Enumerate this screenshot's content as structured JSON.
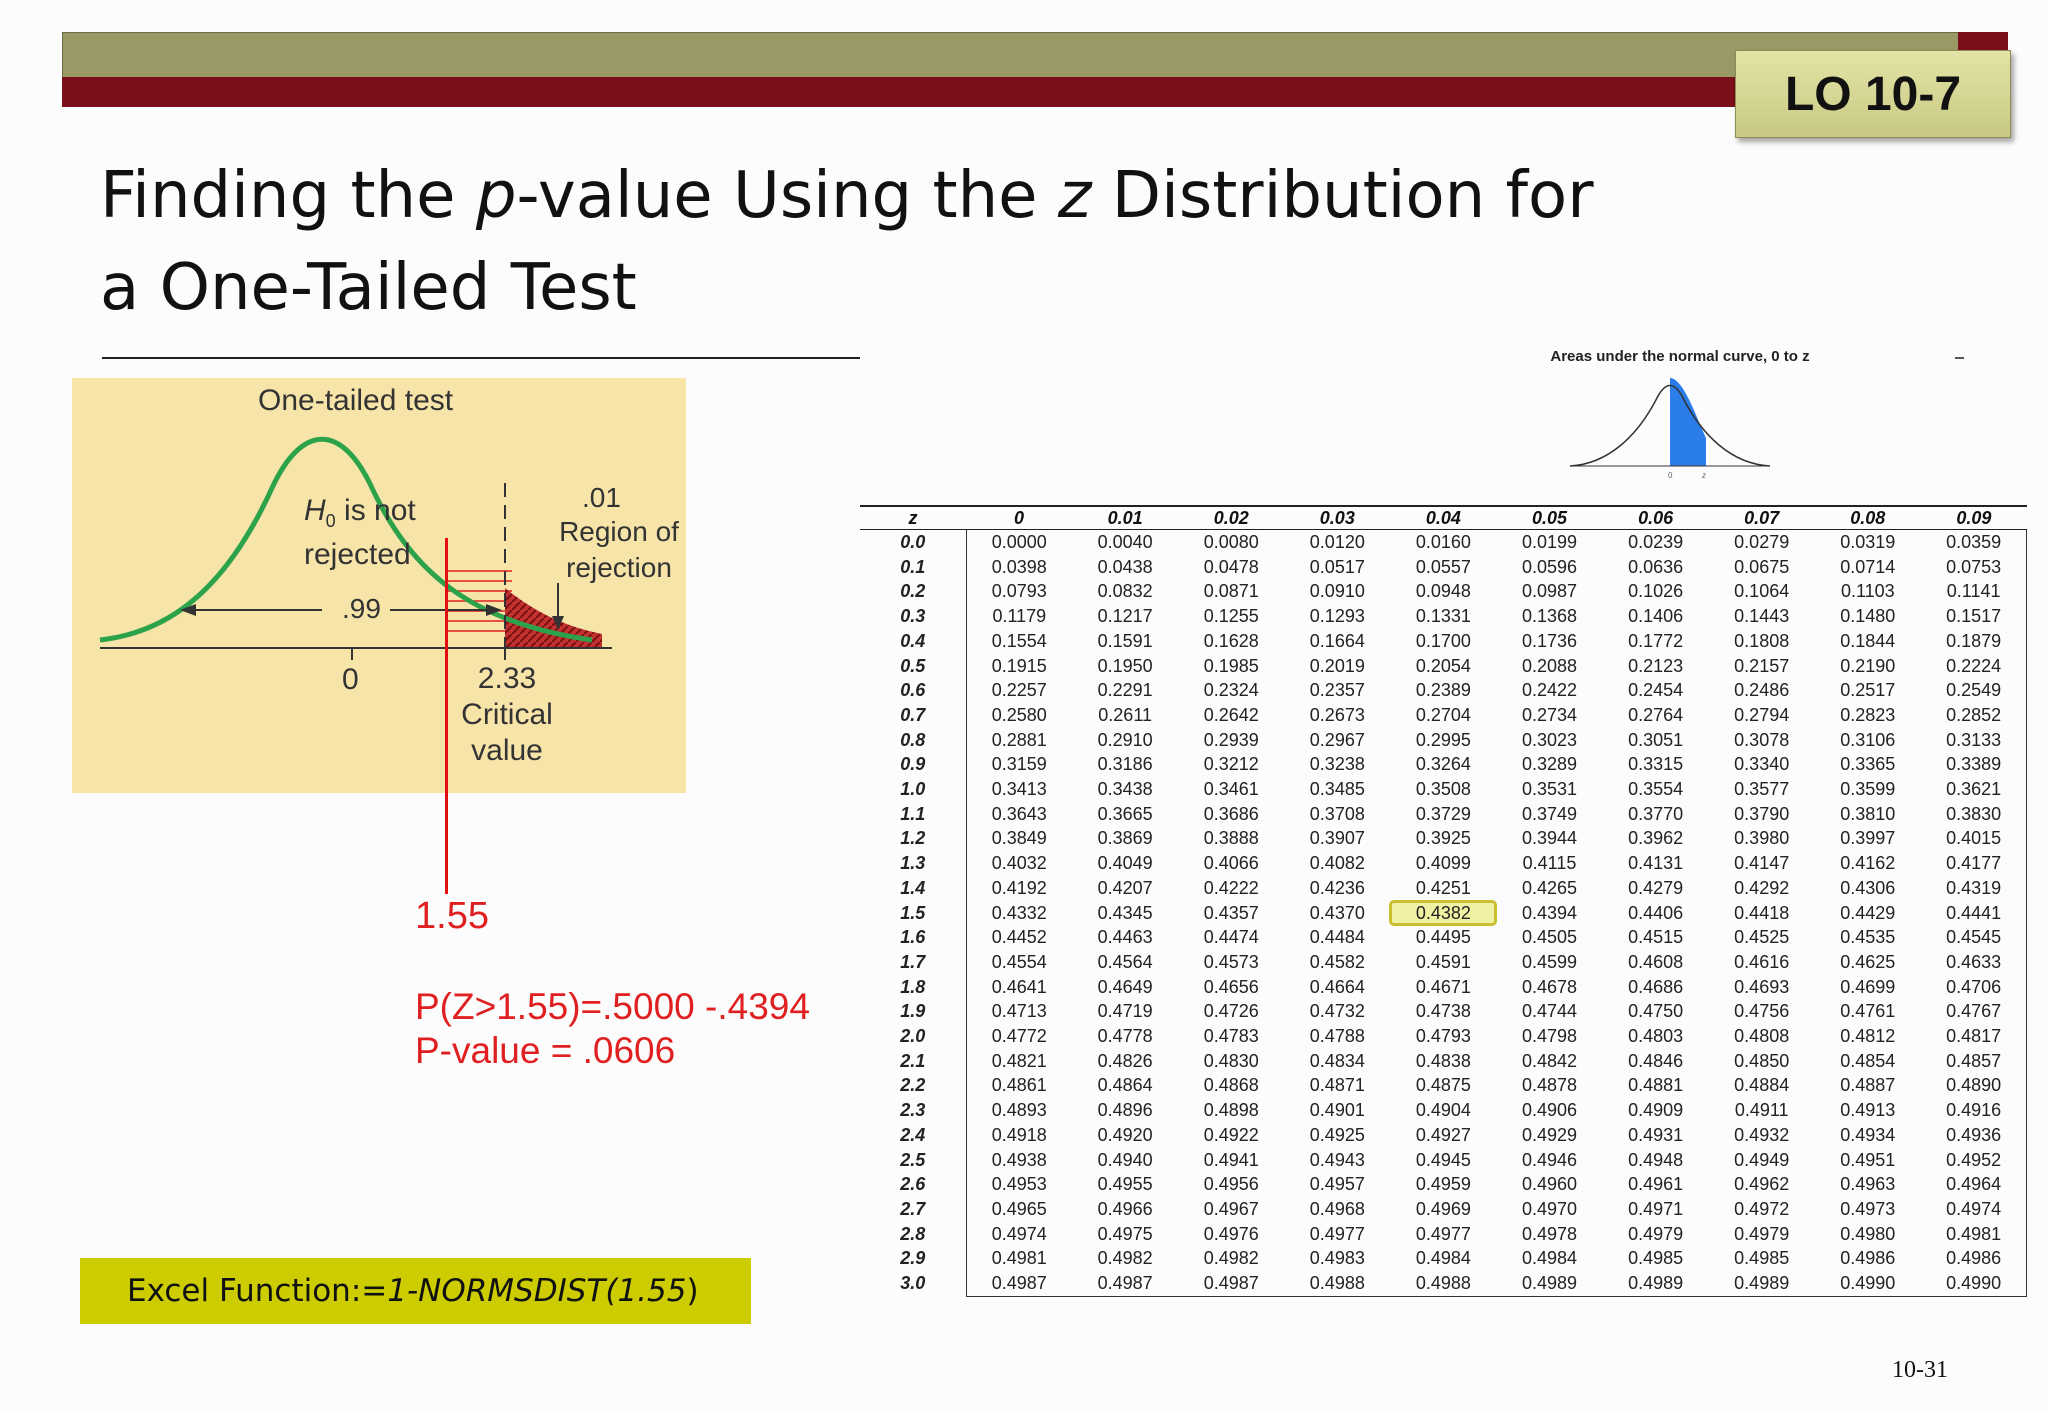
{
  "header": {
    "lo_badge": "LO 10-7"
  },
  "title": {
    "p1": "Finding the ",
    "p_italic": "p",
    "p2": "-value  Using the ",
    "z_italic": "z",
    "p3": " Distribution for",
    "line2": "a One-Tailed Test"
  },
  "figure": {
    "heading": "One-tailed test",
    "h0": "H",
    "h0_sub": "0",
    "h0_rest": " is not",
    "h0_line2": "rejected",
    "alpha": ".01",
    "region1": "Region of",
    "region2": "rejection",
    "ninetynine": ".99",
    "zero": "0",
    "critical_val": "2.33",
    "critical1": "Critical",
    "critical2": "value"
  },
  "calc": {
    "z_value": "1.55",
    "line1": "P(Z>1.55)=.5000 -.4394",
    "line2": "P-value = .0606"
  },
  "excel": {
    "label": "Excel Function: ",
    "fn": "=1-NORMSDIST(1.55",
    "close": ")"
  },
  "ztable": {
    "caption": "Areas under the normal curve, 0 to z",
    "bell_zero": "0",
    "bell_z": "z",
    "headers": [
      "z",
      "0",
      "0.01",
      "0.02",
      "0.03",
      "0.04",
      "0.05",
      "0.06",
      "0.07",
      "0.08",
      "0.09"
    ],
    "highlight": {
      "row": 15,
      "col": 5
    },
    "rows": [
      [
        "0.0",
        "0.0000",
        "0.0040",
        "0.0080",
        "0.0120",
        "0.0160",
        "0.0199",
        "0.0239",
        "0.0279",
        "0.0319",
        "0.0359"
      ],
      [
        "0.1",
        "0.0398",
        "0.0438",
        "0.0478",
        "0.0517",
        "0.0557",
        "0.0596",
        "0.0636",
        "0.0675",
        "0.0714",
        "0.0753"
      ],
      [
        "0.2",
        "0.0793",
        "0.0832",
        "0.0871",
        "0.0910",
        "0.0948",
        "0.0987",
        "0.1026",
        "0.1064",
        "0.1103",
        "0.1141"
      ],
      [
        "0.3",
        "0.1179",
        "0.1217",
        "0.1255",
        "0.1293",
        "0.1331",
        "0.1368",
        "0.1406",
        "0.1443",
        "0.1480",
        "0.1517"
      ],
      [
        "0.4",
        "0.1554",
        "0.1591",
        "0.1628",
        "0.1664",
        "0.1700",
        "0.1736",
        "0.1772",
        "0.1808",
        "0.1844",
        "0.1879"
      ],
      [
        "0.5",
        "0.1915",
        "0.1950",
        "0.1985",
        "0.2019",
        "0.2054",
        "0.2088",
        "0.2123",
        "0.2157",
        "0.2190",
        "0.2224"
      ],
      [
        "0.6",
        "0.2257",
        "0.2291",
        "0.2324",
        "0.2357",
        "0.2389",
        "0.2422",
        "0.2454",
        "0.2486",
        "0.2517",
        "0.2549"
      ],
      [
        "0.7",
        "0.2580",
        "0.2611",
        "0.2642",
        "0.2673",
        "0.2704",
        "0.2734",
        "0.2764",
        "0.2794",
        "0.2823",
        "0.2852"
      ],
      [
        "0.8",
        "0.2881",
        "0.2910",
        "0.2939",
        "0.2967",
        "0.2995",
        "0.3023",
        "0.3051",
        "0.3078",
        "0.3106",
        "0.3133"
      ],
      [
        "0.9",
        "0.3159",
        "0.3186",
        "0.3212",
        "0.3238",
        "0.3264",
        "0.3289",
        "0.3315",
        "0.3340",
        "0.3365",
        "0.3389"
      ],
      [
        "1.0",
        "0.3413",
        "0.3438",
        "0.3461",
        "0.3485",
        "0.3508",
        "0.3531",
        "0.3554",
        "0.3577",
        "0.3599",
        "0.3621"
      ],
      [
        "1.1",
        "0.3643",
        "0.3665",
        "0.3686",
        "0.3708",
        "0.3729",
        "0.3749",
        "0.3770",
        "0.3790",
        "0.3810",
        "0.3830"
      ],
      [
        "1.2",
        "0.3849",
        "0.3869",
        "0.3888",
        "0.3907",
        "0.3925",
        "0.3944",
        "0.3962",
        "0.3980",
        "0.3997",
        "0.4015"
      ],
      [
        "1.3",
        "0.4032",
        "0.4049",
        "0.4066",
        "0.4082",
        "0.4099",
        "0.4115",
        "0.4131",
        "0.4147",
        "0.4162",
        "0.4177"
      ],
      [
        "1.4",
        "0.4192",
        "0.4207",
        "0.4222",
        "0.4236",
        "0.4251",
        "0.4265",
        "0.4279",
        "0.4292",
        "0.4306",
        "0.4319"
      ],
      [
        "1.5",
        "0.4332",
        "0.4345",
        "0.4357",
        "0.4370",
        "0.4382",
        "0.4394",
        "0.4406",
        "0.4418",
        "0.4429",
        "0.4441"
      ],
      [
        "1.6",
        "0.4452",
        "0.4463",
        "0.4474",
        "0.4484",
        "0.4495",
        "0.4505",
        "0.4515",
        "0.4525",
        "0.4535",
        "0.4545"
      ],
      [
        "1.7",
        "0.4554",
        "0.4564",
        "0.4573",
        "0.4582",
        "0.4591",
        "0.4599",
        "0.4608",
        "0.4616",
        "0.4625",
        "0.4633"
      ],
      [
        "1.8",
        "0.4641",
        "0.4649",
        "0.4656",
        "0.4664",
        "0.4671",
        "0.4678",
        "0.4686",
        "0.4693",
        "0.4699",
        "0.4706"
      ],
      [
        "1.9",
        "0.4713",
        "0.4719",
        "0.4726",
        "0.4732",
        "0.4738",
        "0.4744",
        "0.4750",
        "0.4756",
        "0.4761",
        "0.4767"
      ],
      [
        "2.0",
        "0.4772",
        "0.4778",
        "0.4783",
        "0.4788",
        "0.4793",
        "0.4798",
        "0.4803",
        "0.4808",
        "0.4812",
        "0.4817"
      ],
      [
        "2.1",
        "0.4821",
        "0.4826",
        "0.4830",
        "0.4834",
        "0.4838",
        "0.4842",
        "0.4846",
        "0.4850",
        "0.4854",
        "0.4857"
      ],
      [
        "2.2",
        "0.4861",
        "0.4864",
        "0.4868",
        "0.4871",
        "0.4875",
        "0.4878",
        "0.4881",
        "0.4884",
        "0.4887",
        "0.4890"
      ],
      [
        "2.3",
        "0.4893",
        "0.4896",
        "0.4898",
        "0.4901",
        "0.4904",
        "0.4906",
        "0.4909",
        "0.4911",
        "0.4913",
        "0.4916"
      ],
      [
        "2.4",
        "0.4918",
        "0.4920",
        "0.4922",
        "0.4925",
        "0.4927",
        "0.4929",
        "0.4931",
        "0.4932",
        "0.4934",
        "0.4936"
      ],
      [
        "2.5",
        "0.4938",
        "0.4940",
        "0.4941",
        "0.4943",
        "0.4945",
        "0.4946",
        "0.4948",
        "0.4949",
        "0.4951",
        "0.4952"
      ],
      [
        "2.6",
        "0.4953",
        "0.4955",
        "0.4956",
        "0.4957",
        "0.4959",
        "0.4960",
        "0.4961",
        "0.4962",
        "0.4963",
        "0.4964"
      ],
      [
        "2.7",
        "0.4965",
        "0.4966",
        "0.4967",
        "0.4968",
        "0.4969",
        "0.4970",
        "0.4971",
        "0.4972",
        "0.4973",
        "0.4974"
      ],
      [
        "2.8",
        "0.4974",
        "0.4975",
        "0.4976",
        "0.4977",
        "0.4977",
        "0.4978",
        "0.4979",
        "0.4979",
        "0.4980",
        "0.4981"
      ],
      [
        "2.9",
        "0.4981",
        "0.4982",
        "0.4982",
        "0.4983",
        "0.4984",
        "0.4984",
        "0.4985",
        "0.4985",
        "0.4986",
        "0.4986"
      ],
      [
        "3.0",
        "0.4987",
        "0.4987",
        "0.4987",
        "0.4988",
        "0.4988",
        "0.4989",
        "0.4989",
        "0.4989",
        "0.4990",
        "0.4990"
      ]
    ]
  },
  "footer": {
    "page": "10-31"
  },
  "colors": {
    "olive_bar": "#999966",
    "maroon_bar": "#7a0e1a",
    "accent_red": "#e02020",
    "excel_box": "#cccc00",
    "highlight": "#c9bf30"
  }
}
